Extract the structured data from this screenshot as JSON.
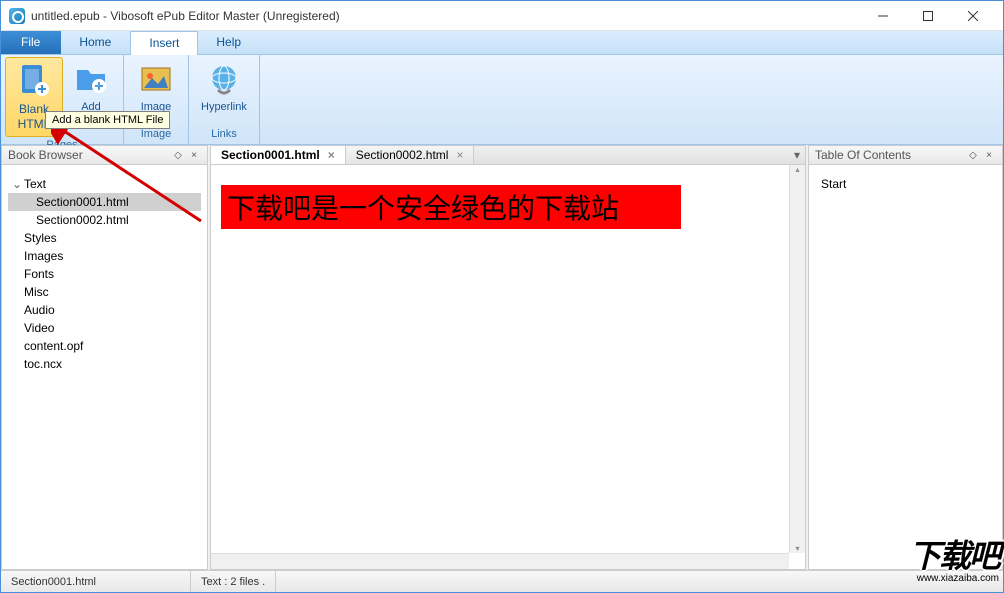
{
  "titlebar": {
    "title": "untitled.epub - Vibosoft ePub Editor Master (Unregistered)"
  },
  "menubar": {
    "file": "File",
    "home": "Home",
    "insert": "Insert",
    "help": "Help"
  },
  "ribbon": {
    "pages": {
      "label": "Pages",
      "blank_html": "Blank\nHTML",
      "add": "Add"
    },
    "image": {
      "label": "Image",
      "image_btn": "Image"
    },
    "links": {
      "label": "Links",
      "hyperlink": "Hyperlink"
    }
  },
  "tooltip": "Add a blank HTML File",
  "book_browser": {
    "title": "Book Browser",
    "root": "Text",
    "items": [
      "Section0001.html",
      "Section0002.html"
    ],
    "others": [
      "Styles",
      "Images",
      "Fonts",
      "Misc",
      "Audio",
      "Video",
      "content.opf",
      "toc.ncx"
    ]
  },
  "editor": {
    "tabs": [
      "Section0001.html",
      "Section0002.html"
    ],
    "content_text": "下载吧是一个安全绿色的下载站"
  },
  "toc": {
    "title": "Table Of Contents",
    "items": [
      "Start"
    ]
  },
  "statusbar": {
    "file": "Section0001.html",
    "info": "Text : 2 files ."
  },
  "watermark": {
    "main": "下载吧",
    "sub": "www.xiazaiba.com"
  }
}
